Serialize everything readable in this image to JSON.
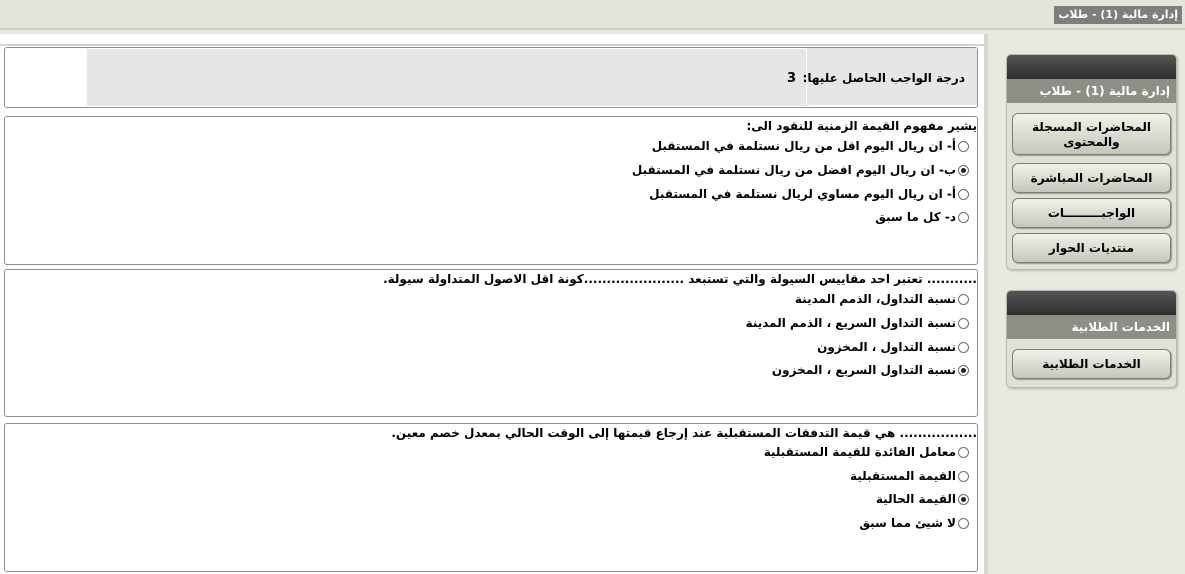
{
  "header": {
    "title": "إدارة مالية (1) - طلاب"
  },
  "grade": {
    "label": "درجة الواجب الحاصل عليها:",
    "value": "3"
  },
  "questions": [
    {
      "text": "يشير مفهوم القيمة الزمنية للنقود الى:",
      "options": [
        {
          "label": "أ- ان ريال اليوم اقل من ريال نستلمة في المستقبل",
          "selected": false
        },
        {
          "label": "ب- ان ريال اليوم افضل من ريال نستلمة في المستقبل",
          "selected": true
        },
        {
          "label": "أ- ان ريال اليوم مساوي لريال نستلمة في المستقبل",
          "selected": false
        },
        {
          "label": "د- كل ما سبق",
          "selected": false
        }
      ]
    },
    {
      "text": "........... تعتبر احد مقاييس السيولة والتي تستبعد ......................كونة اقل الاصول المتداولة سيولة.",
      "options": [
        {
          "label": "نسبة التداول، الذمم المدينة",
          "selected": false
        },
        {
          "label": "نسبة التداول السريع ، الذمم المدينة",
          "selected": false
        },
        {
          "label": "نسبة التداول ، المخزون",
          "selected": false
        },
        {
          "label": "نسبة التداول السريع ، المخزون",
          "selected": true
        }
      ]
    },
    {
      "text": "................. هي قيمة التدفقات المستقبلية عند إرجاع قيمتها إلى الوقت الحالي بمعدل خصم معين.",
      "options": [
        {
          "label": "معامل الفائدة للقيمة المستقبلية",
          "selected": false
        },
        {
          "label": "القيمة المستقبلية",
          "selected": false
        },
        {
          "label": "القيمة الحالية",
          "selected": true
        },
        {
          "label": "لا شيئ مما سبق",
          "selected": false
        }
      ]
    }
  ],
  "sidebar": {
    "course_panel": {
      "title": "إدارة مالية (1) - طلاب",
      "items": [
        {
          "label": "المحاضرات المسجلة والمحتوى"
        },
        {
          "label": "المحاضرات المباشرة"
        },
        {
          "label": "الواجبـــــــــات"
        },
        {
          "label": "منتديات الحوار"
        }
      ]
    },
    "services_panel": {
      "title": "الخدمات الطلابية",
      "items": [
        {
          "label": "الخدمات الطلابية"
        }
      ]
    }
  }
}
